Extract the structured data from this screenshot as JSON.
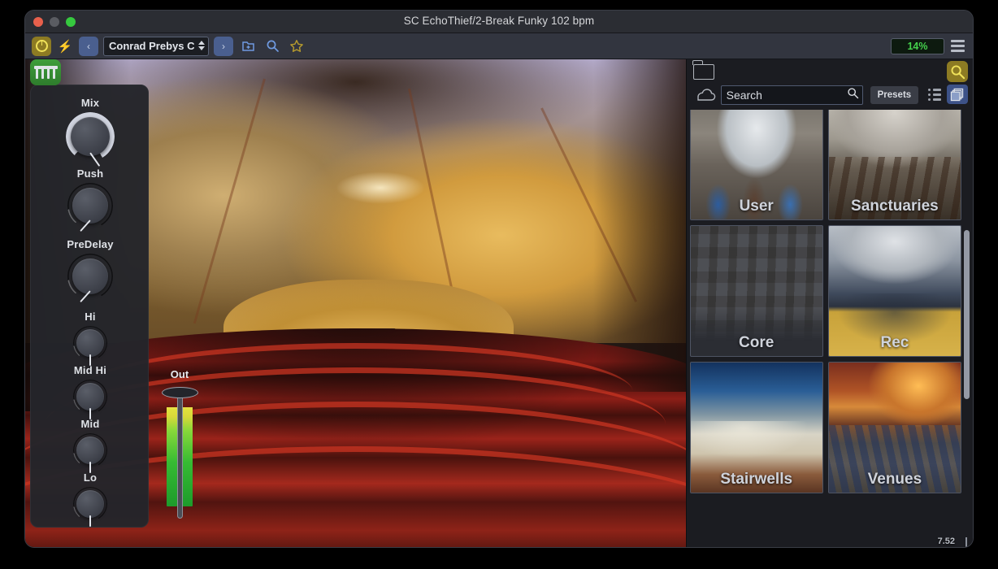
{
  "window": {
    "title": "SC EchoThief/2-Break Funky 102 bpm",
    "traffic_lights": [
      "close",
      "minimize",
      "zoom"
    ]
  },
  "toolbar": {
    "power_icon": "power-knob-icon",
    "bolt_icon": "bolt-icon",
    "prev_label": "‹",
    "next_label": "›",
    "preset_name": "Conrad Prebys C",
    "save_icon": "save-preset-icon",
    "search_icon": "search-icon",
    "favorite_icon": "star-icon",
    "cpu_value": "14%",
    "menu_icon": "hamburger-menu-icon",
    "cpu_color": "#44d14c"
  },
  "plugin": {
    "badge_icon": "mixer-faders-icon",
    "badge_color": "#3f9e3b",
    "knobs": [
      {
        "label": "Mix",
        "size": "large"
      },
      {
        "label": "Push",
        "size": "medium"
      },
      {
        "label": "PreDelay",
        "size": "medium"
      },
      {
        "label": "Hi",
        "size": "small"
      },
      {
        "label": "Mid Hi",
        "size": "small"
      },
      {
        "label": "Mid",
        "size": "small"
      },
      {
        "label": "Lo",
        "size": "small"
      }
    ],
    "output": {
      "label": "Out",
      "fader_icon": "fader-handle-icon",
      "meter_icon": "stereo-level-meter"
    },
    "artwork_caption": "concert-hall-panorama"
  },
  "browser": {
    "folder_icon": "folder-icon",
    "cloud_icon": "cloud-icon",
    "search_placeholder": "Search",
    "search_value": "Search",
    "search_icon": "search-icon",
    "presets_label": "Presets",
    "list_view_icon": "list-view-icon",
    "grid_view_icon": "grid-view-icon",
    "magnifier_icon": "magnifier-icon",
    "active_view": "grid",
    "version": "7.52",
    "tiles": [
      {
        "name": "User",
        "art": "art-user"
      },
      {
        "name": "Sanctuaries",
        "art": "art-sanct"
      },
      {
        "name": "Core",
        "art": "art-core"
      },
      {
        "name": "Rec",
        "art": "art-rec"
      },
      {
        "name": "Stairwells",
        "art": "art-stairs"
      },
      {
        "name": "Venues",
        "art": "art-venues"
      }
    ]
  }
}
